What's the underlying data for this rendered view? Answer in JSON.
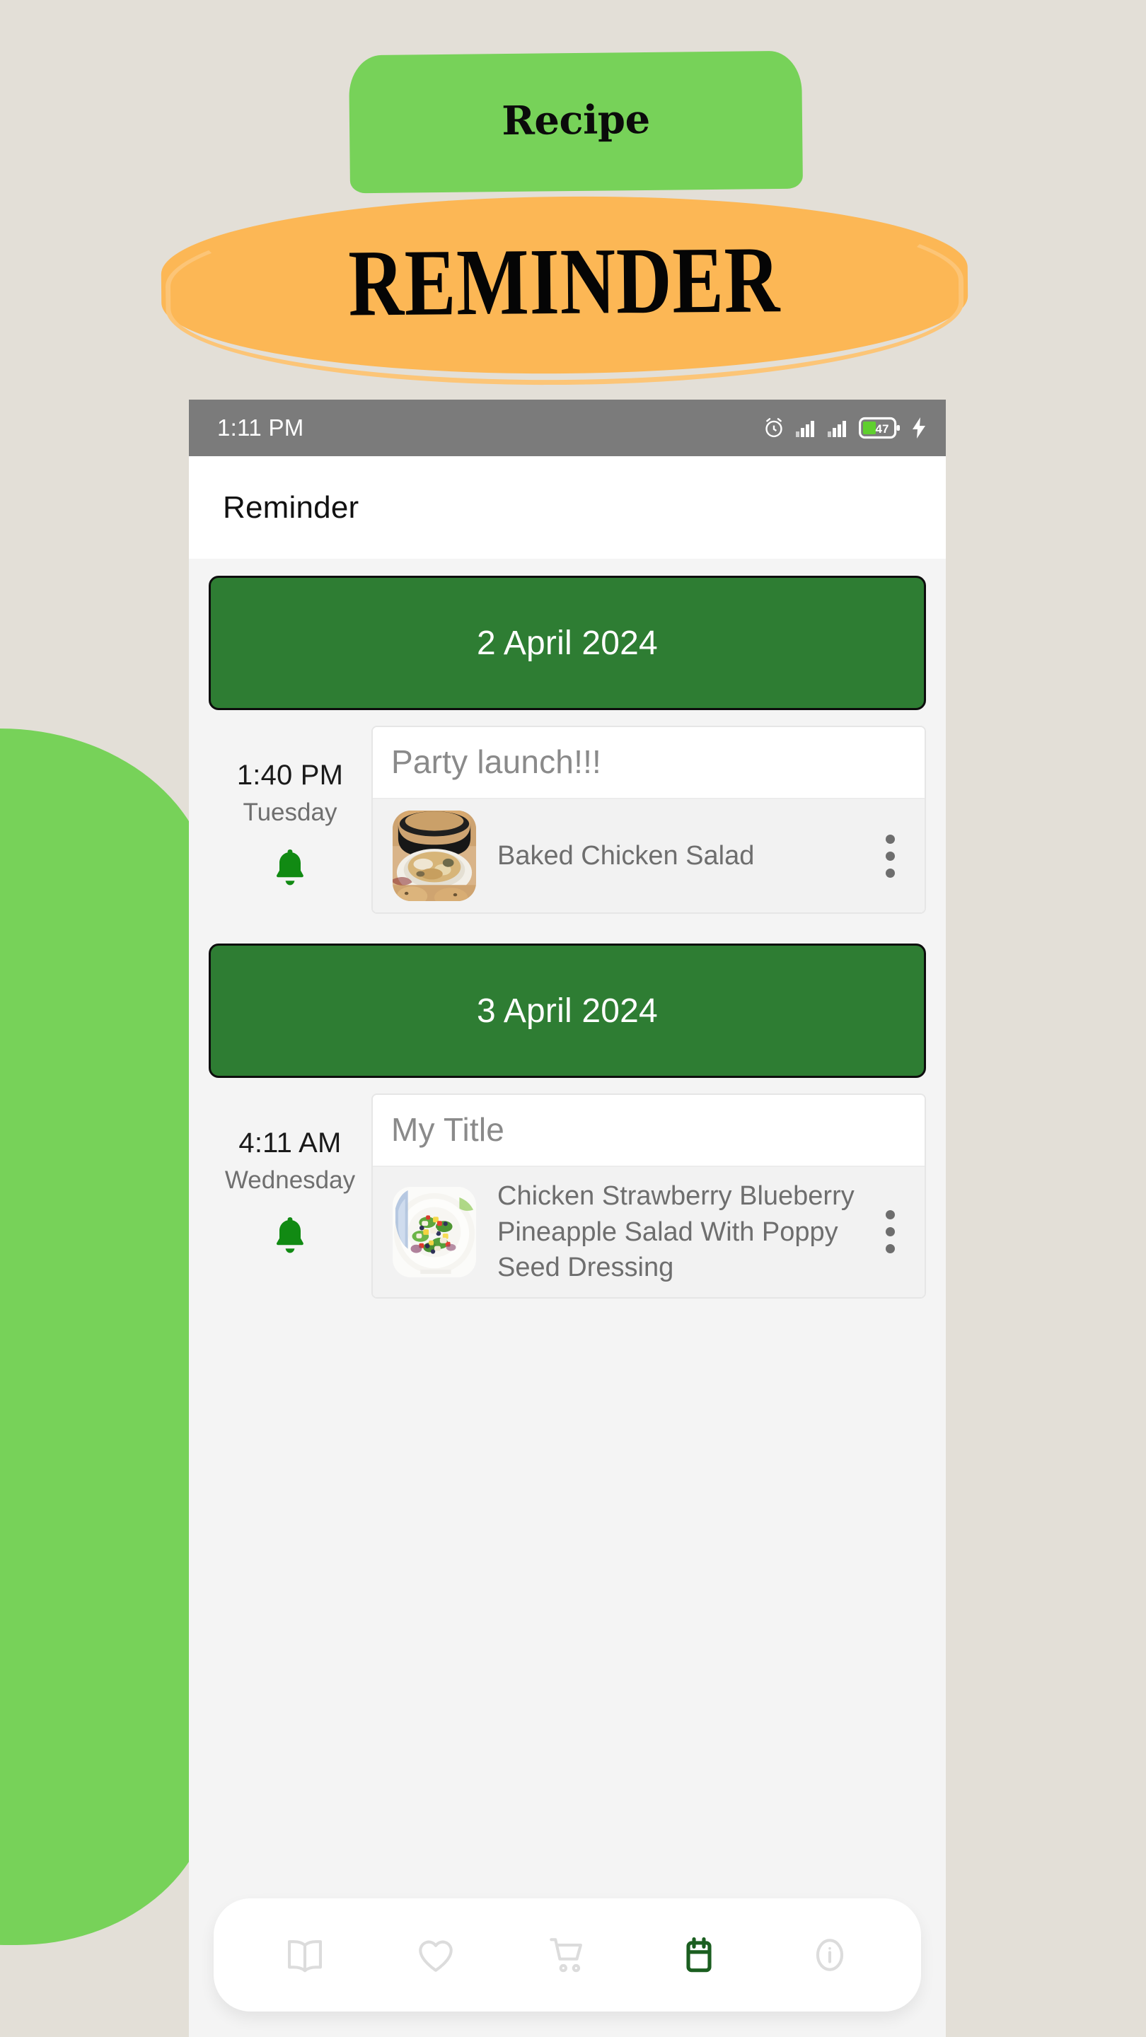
{
  "poster": {
    "top_label": "Recipe",
    "main_label": "REMINDER",
    "colors": {
      "background": "#e3dfd7",
      "green_banner": "#77d259",
      "orange_banner": "#fcb755",
      "orange_outline": "#fcc577"
    }
  },
  "status_bar": {
    "time": "1:11 PM",
    "icons": [
      "alarm-icon",
      "signal-icon-1",
      "signal-icon-2",
      "battery-icon",
      "charging-bolt-icon"
    ],
    "battery_percent": "47",
    "background": "#7b7b7b"
  },
  "app_bar": {
    "title": "Reminder",
    "background": "#ffffff"
  },
  "groups": [
    {
      "date": "2 April 2024",
      "reminders": [
        {
          "time": "1:40 PM",
          "weekday": "Tuesday",
          "alarm_icon": "bell-icon",
          "title": "Party launch!!!",
          "recipe_name": "Baked Chicken Salad",
          "thumbnail": "baked-chicken-salad-thumbnail",
          "menu_icon": "more-vertical-icon"
        }
      ]
    },
    {
      "date": "3 April 2024",
      "reminders": [
        {
          "time": "4:11 AM",
          "weekday": "Wednesday",
          "alarm_icon": "bell-icon",
          "title": "My Title",
          "recipe_name": "Chicken Strawberry Blueberry Pineapple Salad With Poppy Seed Dressing",
          "thumbnail": "chicken-strawberry-salad-thumbnail",
          "menu_icon": "more-vertical-icon"
        }
      ]
    }
  ],
  "bottom_nav": {
    "items": [
      {
        "icon": "book-icon",
        "active": false
      },
      {
        "icon": "heart-icon",
        "active": false
      },
      {
        "icon": "cart-icon",
        "active": false
      },
      {
        "icon": "calendar-icon",
        "active": true
      },
      {
        "icon": "info-icon",
        "active": false
      }
    ],
    "active_color": "#1b5e20",
    "inactive_color": "#dcdcdc"
  },
  "theme": {
    "date_banner_green": "#2e7d33",
    "bell_green": "#118a13",
    "screen_background": "#f4f4f4"
  }
}
